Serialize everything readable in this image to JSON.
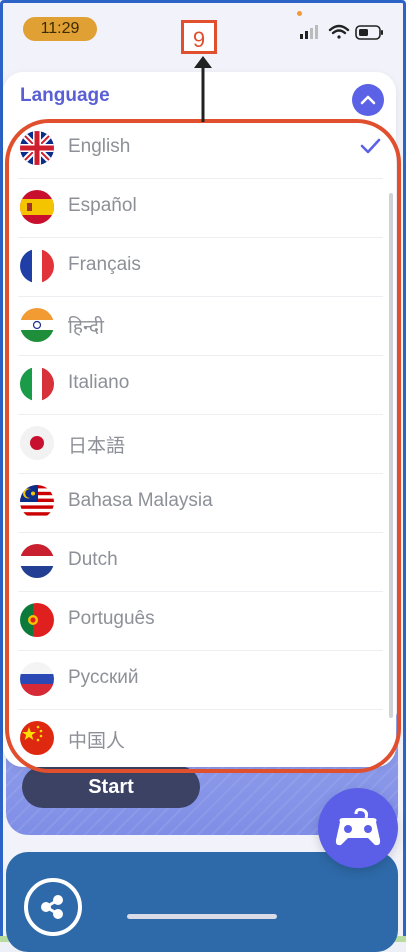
{
  "status_bar": {
    "time": "11:29",
    "annotation_number": "9"
  },
  "sheet": {
    "title": "Language",
    "selected": "English",
    "languages": [
      {
        "label": "English",
        "flag": "uk-flag-icon"
      },
      {
        "label": "Español",
        "flag": "spain-flag-icon"
      },
      {
        "label": "Français",
        "flag": "france-flag-icon"
      },
      {
        "label": "हिन्दी",
        "flag": "india-flag-icon"
      },
      {
        "label": "Italiano",
        "flag": "italy-flag-icon"
      },
      {
        "label": "日本語",
        "flag": "japan-flag-icon"
      },
      {
        "label": "Bahasa Malaysia",
        "flag": "malaysia-flag-icon"
      },
      {
        "label": "Dutch",
        "flag": "netherlands-flag-icon"
      },
      {
        "label": "Português",
        "flag": "portugal-flag-icon"
      },
      {
        "label": "Русский",
        "flag": "russia-flag-icon"
      },
      {
        "label": "中国人",
        "flag": "china-flag-icon"
      }
    ]
  },
  "background": {
    "start_label": "Start"
  },
  "colors": {
    "accent": "#5b62e6",
    "highlight": "#e0502f",
    "time_pill": "#e0a033"
  }
}
